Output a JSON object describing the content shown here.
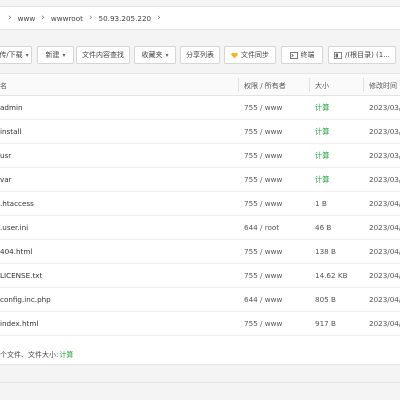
{
  "breadcrumb": [
    "www",
    "wwwroot",
    "50.93.205.220"
  ],
  "toolbar": {
    "upload_download": "传/下载",
    "new": "新建",
    "content_search": "文件内容查找",
    "favorites": "收藏夹",
    "share_list": "分享列表",
    "file_sync": "文件同步",
    "terminal": "终端",
    "path": "/(根目录) (1..."
  },
  "table": {
    "headers": {
      "name": "名",
      "perm": "权限 / 所有者",
      "size": "大小",
      "date": "修改时间"
    },
    "rows": [
      {
        "name": "admin",
        "perm": "755 / www",
        "size": "计算",
        "date": "2023/03/"
      },
      {
        "name": "install",
        "perm": "755 / www",
        "size": "计算",
        "date": "2023/03/"
      },
      {
        "name": "usr",
        "perm": "755 / www",
        "size": "计算",
        "date": "2023/03/"
      },
      {
        "name": "var",
        "perm": "755 / www",
        "size": "计算",
        "date": "2023/03/"
      },
      {
        "name": ".htaccess",
        "perm": "755 / www",
        "size": "1 B",
        "date": "2023/04/"
      },
      {
        "name": ".user.ini",
        "perm": "644 / root",
        "size": "46 B",
        "date": "2023/04/"
      },
      {
        "name": "404.html",
        "perm": "755 / www",
        "size": "138 B",
        "date": "2023/04/"
      },
      {
        "name": "LICENSE.txt",
        "perm": "755 / www",
        "size": "14.62 KB",
        "date": "2023/04/"
      },
      {
        "name": "config.inc.php",
        "perm": "644 / www",
        "size": "805 B",
        "date": "2023/04/"
      },
      {
        "name": "index.html",
        "perm": "755 / www",
        "size": "917 B",
        "date": "2023/04/"
      }
    ]
  },
  "footer": {
    "summary": "个文件、文件大小:",
    "calc": "计算"
  },
  "colors": {
    "green": "#20a53a",
    "sync_icon": "#f0b429"
  }
}
